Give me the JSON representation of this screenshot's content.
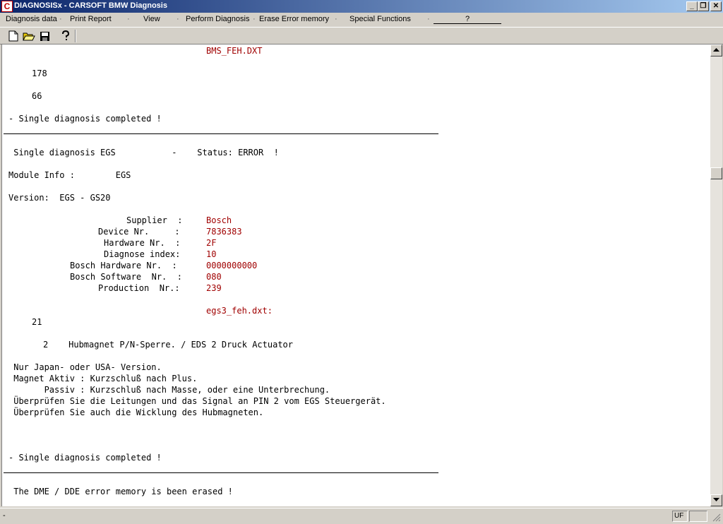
{
  "window": {
    "icon_letter": "C",
    "title": "DIAGNOSISx - CARSOFT BMW Diagnosis",
    "minimize": "_",
    "restore": "❐",
    "close": "✕"
  },
  "menu": {
    "items": [
      "Diagnosis data",
      "Print Report",
      "View",
      "Perform Diagnosis",
      "Erase Error memory",
      "Special Functions"
    ],
    "help": "?"
  },
  "content": {
    "lines": [
      {
        "text": "BMS_FEH.DXT",
        "red": true
      },
      {
        "text": "178"
      },
      {
        "text": "66"
      },
      {
        "text": "- Single diagnosis completed !"
      },
      {
        "text": " Single diagnosis EGS           -    Status: ERROR  !"
      },
      {
        "text": "Module Info :        EGS"
      },
      {
        "text": "Version:  EGS - GS20"
      },
      {
        "text": "Supplier  :"
      },
      {
        "text": "Device Nr.     :"
      },
      {
        "text": "Hardware Nr.  :"
      },
      {
        "text": "Diagnose index:"
      },
      {
        "text": "Bosch Hardware Nr.  :"
      },
      {
        "text": "Bosch Software  Nr.  :"
      },
      {
        "text": "Production  Nr.:"
      },
      {
        "text": "egs3_feh.dxt:",
        "red": true
      },
      {
        "text": "21"
      },
      {
        "text": "2    Hubmagnet P/N-Sperre. / EDS 2 Druck Actuator"
      },
      {
        "text": " Nur Japan- oder USA- Version."
      },
      {
        "text": " Magnet Aktiv : Kurzschluß nach Plus."
      },
      {
        "text": "       Passiv : Kurzschluß nach Masse, oder eine Unterbrechung."
      },
      {
        "text": " Überprüfen Sie die Leitungen und das Signal an PIN 2 vom EGS Steuergerät."
      },
      {
        "text": " Überprüfen Sie auch die Wicklung des Hubmagneten."
      },
      {
        "text": "- Single diagnosis completed !"
      },
      {
        "text": " The DME / DDE error memory is been erased !"
      }
    ],
    "values": [
      "Bosch",
      "7836383",
      "2F",
      "10",
      "0000000000",
      "080",
      "239"
    ]
  },
  "status": {
    "left": "-",
    "indicator": "UF",
    "box2": ""
  }
}
